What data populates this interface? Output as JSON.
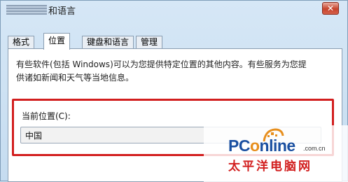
{
  "window": {
    "title": "和语言",
    "close_symbol": "✕"
  },
  "tabs": [
    {
      "label": "格式",
      "active": false
    },
    {
      "label": "位置",
      "active": true
    },
    {
      "label": "键盘和语言",
      "active": false
    },
    {
      "label": "管理",
      "active": false
    }
  ],
  "location": {
    "description_line1": "有些软件(包括 Windows)可以为您提供特定位置的其他内容。有些服务为您提",
    "description_line2": "供诸如新闻和天气等当地信息。",
    "current_label": "当前位置(C):",
    "current_value": "中国"
  },
  "watermark": {
    "logo_text_pc": "PC",
    "logo_text_o": "o",
    "logo_text_rest": "nline",
    "logo_domain": ".com.cn",
    "logo_cn": "太平洋电脑网"
  },
  "colors": {
    "highlight": "#d21e1e",
    "watermark_blue": "#1a4fa0",
    "watermark_orange": "#e78f1e"
  }
}
